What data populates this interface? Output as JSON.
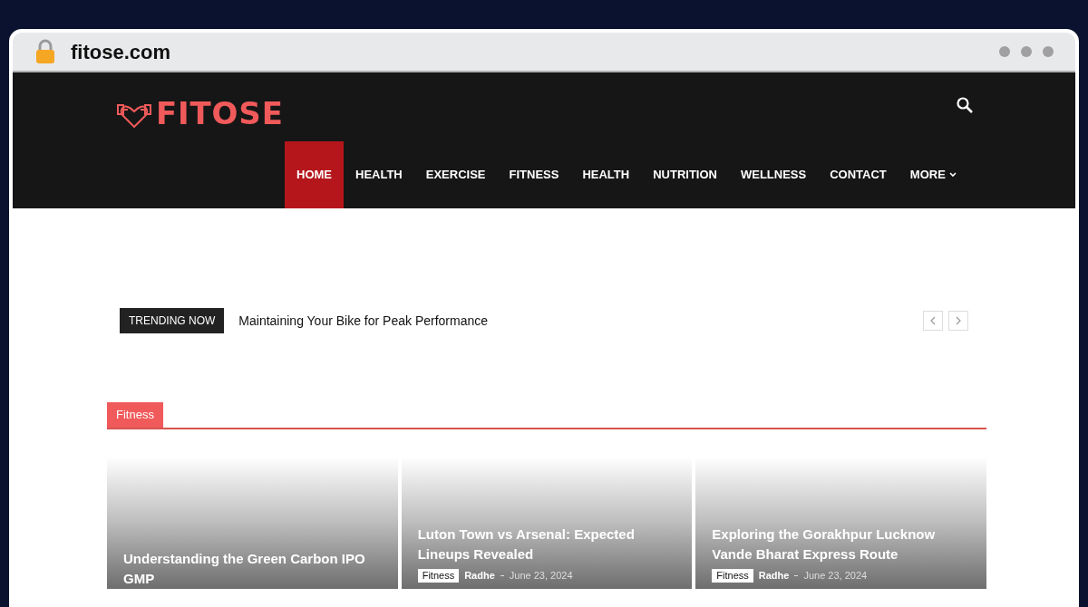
{
  "browser": {
    "url": "fitose.com"
  },
  "site": {
    "logo": "FITOSE"
  },
  "nav": [
    {
      "label": "HOME",
      "selected": true
    },
    {
      "label": "HEALTH",
      "selected": false
    },
    {
      "label": "EXERCISE",
      "selected": false
    },
    {
      "label": "FITNESS",
      "selected": false
    },
    {
      "label": "HEALTH",
      "selected": false
    },
    {
      "label": "NUTRITION",
      "selected": false
    },
    {
      "label": "WELLNESS",
      "selected": false
    },
    {
      "label": "CONTACT",
      "selected": false
    },
    {
      "label": "MORE",
      "selected": false,
      "dropdown": true
    }
  ],
  "trending": {
    "label": "TRENDING NOW",
    "headline": "Maintaining Your Bike for Peak Performance"
  },
  "section": {
    "title": "Fitness"
  },
  "cards": [
    {
      "title": "Understanding the Green Carbon IPO GMP"
    },
    {
      "title": "Luton Town vs Arsenal: Expected Lineups Revealed",
      "category": "Fitness",
      "author": "Radhe",
      "date": "June 23, 2024"
    },
    {
      "title": "Exploring the Gorakhpur Lucknow Vande Bharat Express Route",
      "category": "Fitness",
      "author": "Radhe",
      "date": "June 23, 2024"
    }
  ]
}
